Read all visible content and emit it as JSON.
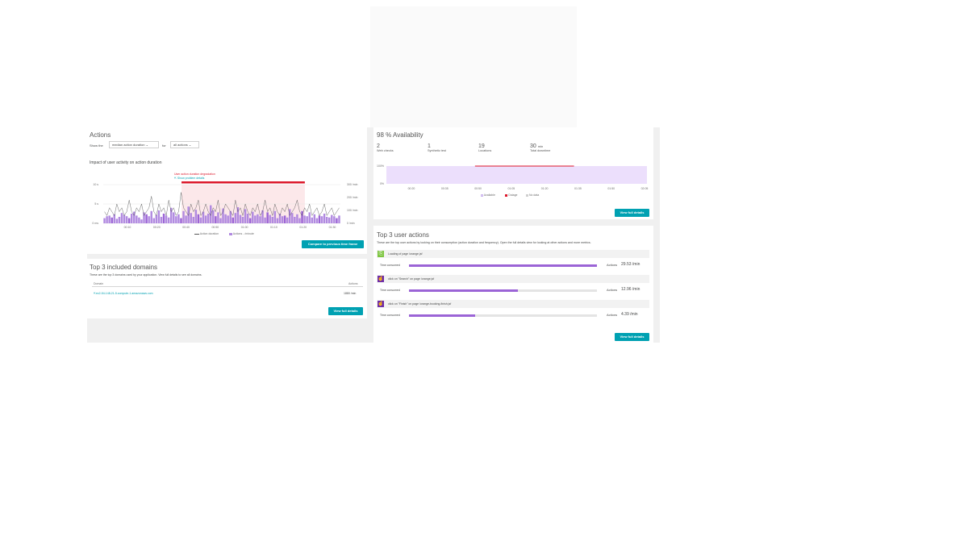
{
  "actions_panel": {
    "title": "Actions",
    "show_the": "Show the",
    "metric_dropdown": "median action duration",
    "for": "for",
    "actions_dropdown": "all actions",
    "subtitle": "Impact of user activity on action duration",
    "alert_title": "User action duration degradation",
    "alert_link": "Show problem details",
    "y_left_ticks": [
      "10 s",
      "5 s",
      "0 ms"
    ],
    "y_right_ticks": [
      "300 /min",
      "200 /min",
      "100 /min",
      "0 /min"
    ],
    "x_ticks": [
      "00:10",
      "00:20",
      "00:40",
      "00:50",
      "01:00",
      "01:10",
      "01:20",
      "01:30"
    ],
    "legend_duration": "Action duration",
    "legend_actions": "Actions - /minute",
    "compare_button": "Compare to previous time frame"
  },
  "chart_data": {
    "type": "bar",
    "series": [
      {
        "name": "Actions - /minute",
        "values": [
          40,
          55,
          60,
          45,
          70,
          35,
          50,
          80,
          65,
          55,
          40,
          75,
          90,
          60,
          45,
          30,
          85,
          70,
          55,
          95,
          40,
          65,
          100,
          50,
          75,
          60,
          45,
          120,
          85,
          55,
          70,
          40,
          95,
          60,
          130,
          80,
          50,
          105,
          70,
          45,
          90,
          60,
          75,
          140,
          100,
          55,
          85,
          40,
          115,
          70,
          60,
          95,
          45,
          80,
          125,
          65,
          50,
          110,
          75,
          40,
          90,
          60,
          70,
          55,
          100,
          45,
          85,
          65,
          50,
          95,
          40,
          75,
          55,
          60,
          45,
          110,
          80,
          50,
          70,
          40,
          95,
          60,
          55,
          85,
          45,
          70,
          40,
          60,
          55,
          75,
          50,
          45,
          65,
          55,
          40,
          60
        ]
      },
      {
        "name": "Action duration",
        "values": [
          3,
          2,
          4,
          3,
          2,
          5,
          3,
          4,
          2,
          3,
          6,
          3,
          2,
          4,
          3,
          5,
          2,
          3,
          4,
          7,
          3,
          2,
          5,
          3,
          4,
          2,
          6,
          3,
          4,
          2,
          3,
          8,
          4,
          3,
          2,
          5,
          3,
          4,
          6,
          2,
          3,
          5,
          3,
          2,
          4,
          3,
          6,
          2,
          3,
          5,
          4,
          3,
          2,
          6,
          3,
          4,
          2,
          5,
          3,
          2,
          4,
          3,
          5,
          2,
          3,
          6,
          3,
          4,
          2,
          5,
          3,
          2,
          4,
          3,
          5,
          2,
          3,
          4,
          6,
          3,
          2,
          4,
          3,
          5,
          2,
          3,
          4,
          2,
          3,
          5,
          2,
          3,
          4,
          2,
          3,
          4
        ]
      }
    ],
    "ylim_left": [
      0,
      10
    ],
    "ylim_right": [
      0,
      300
    ]
  },
  "domains_panel": {
    "title": "Top 3 included domains",
    "description": "These are the top 3 domains used by your application. View full details to see all domains.",
    "col_domain": "Domain",
    "col_actions": "Actions",
    "rows": [
      {
        "domain": "ec2-54-148-21-5.compute-1.amazonaws.com",
        "actions": "1880 /min"
      }
    ],
    "button": "View full details"
  },
  "availability_panel": {
    "title": "98 % Availability",
    "stats": [
      {
        "value": "2",
        "unit": "",
        "label": "Web checks"
      },
      {
        "value": "1",
        "unit": "",
        "label": "Synthetic test"
      },
      {
        "value": "19",
        "unit": "",
        "label": "Locations"
      },
      {
        "value": "30",
        "unit": "min",
        "label": "Total downtime"
      }
    ],
    "y_ticks": [
      "100%",
      "0%"
    ],
    "x_ticks": [
      "00:20",
      "00:35",
      "00:50",
      "01:05",
      "01:20",
      "01:35",
      "01:50",
      "02:05"
    ],
    "legend": [
      "Available",
      "Outage",
      "No data"
    ],
    "button": "View full details"
  },
  "user_actions_panel": {
    "title": "Top 3 user actions",
    "description": "These are the top user actions by looking on their consumption (action duration and frequency). Open the full details view for looking at other actions and more metrics.",
    "time_consumed_label": "Time consumed",
    "actions_label": "Actions",
    "items": [
      {
        "name": "Loading of page /orange.jsf",
        "consumed": 1.0,
        "value": "29.53",
        "unit": "/min"
      },
      {
        "name": "click on \"Search\" on page /orange.jsf",
        "consumed": 0.58,
        "value": "12.96",
        "unit": "/min"
      },
      {
        "name": "click on \"Finish\" on page /orange-booking-finish.jsf",
        "consumed": 0.35,
        "value": "4.39",
        "unit": "/min"
      }
    ],
    "button": "View full details"
  },
  "colors": {
    "accent": "#00a1b2",
    "bar": "#b18ae0",
    "bar_dark": "#9b64d6",
    "alert": "#dc172a",
    "available_fill": "#ecdffc"
  }
}
